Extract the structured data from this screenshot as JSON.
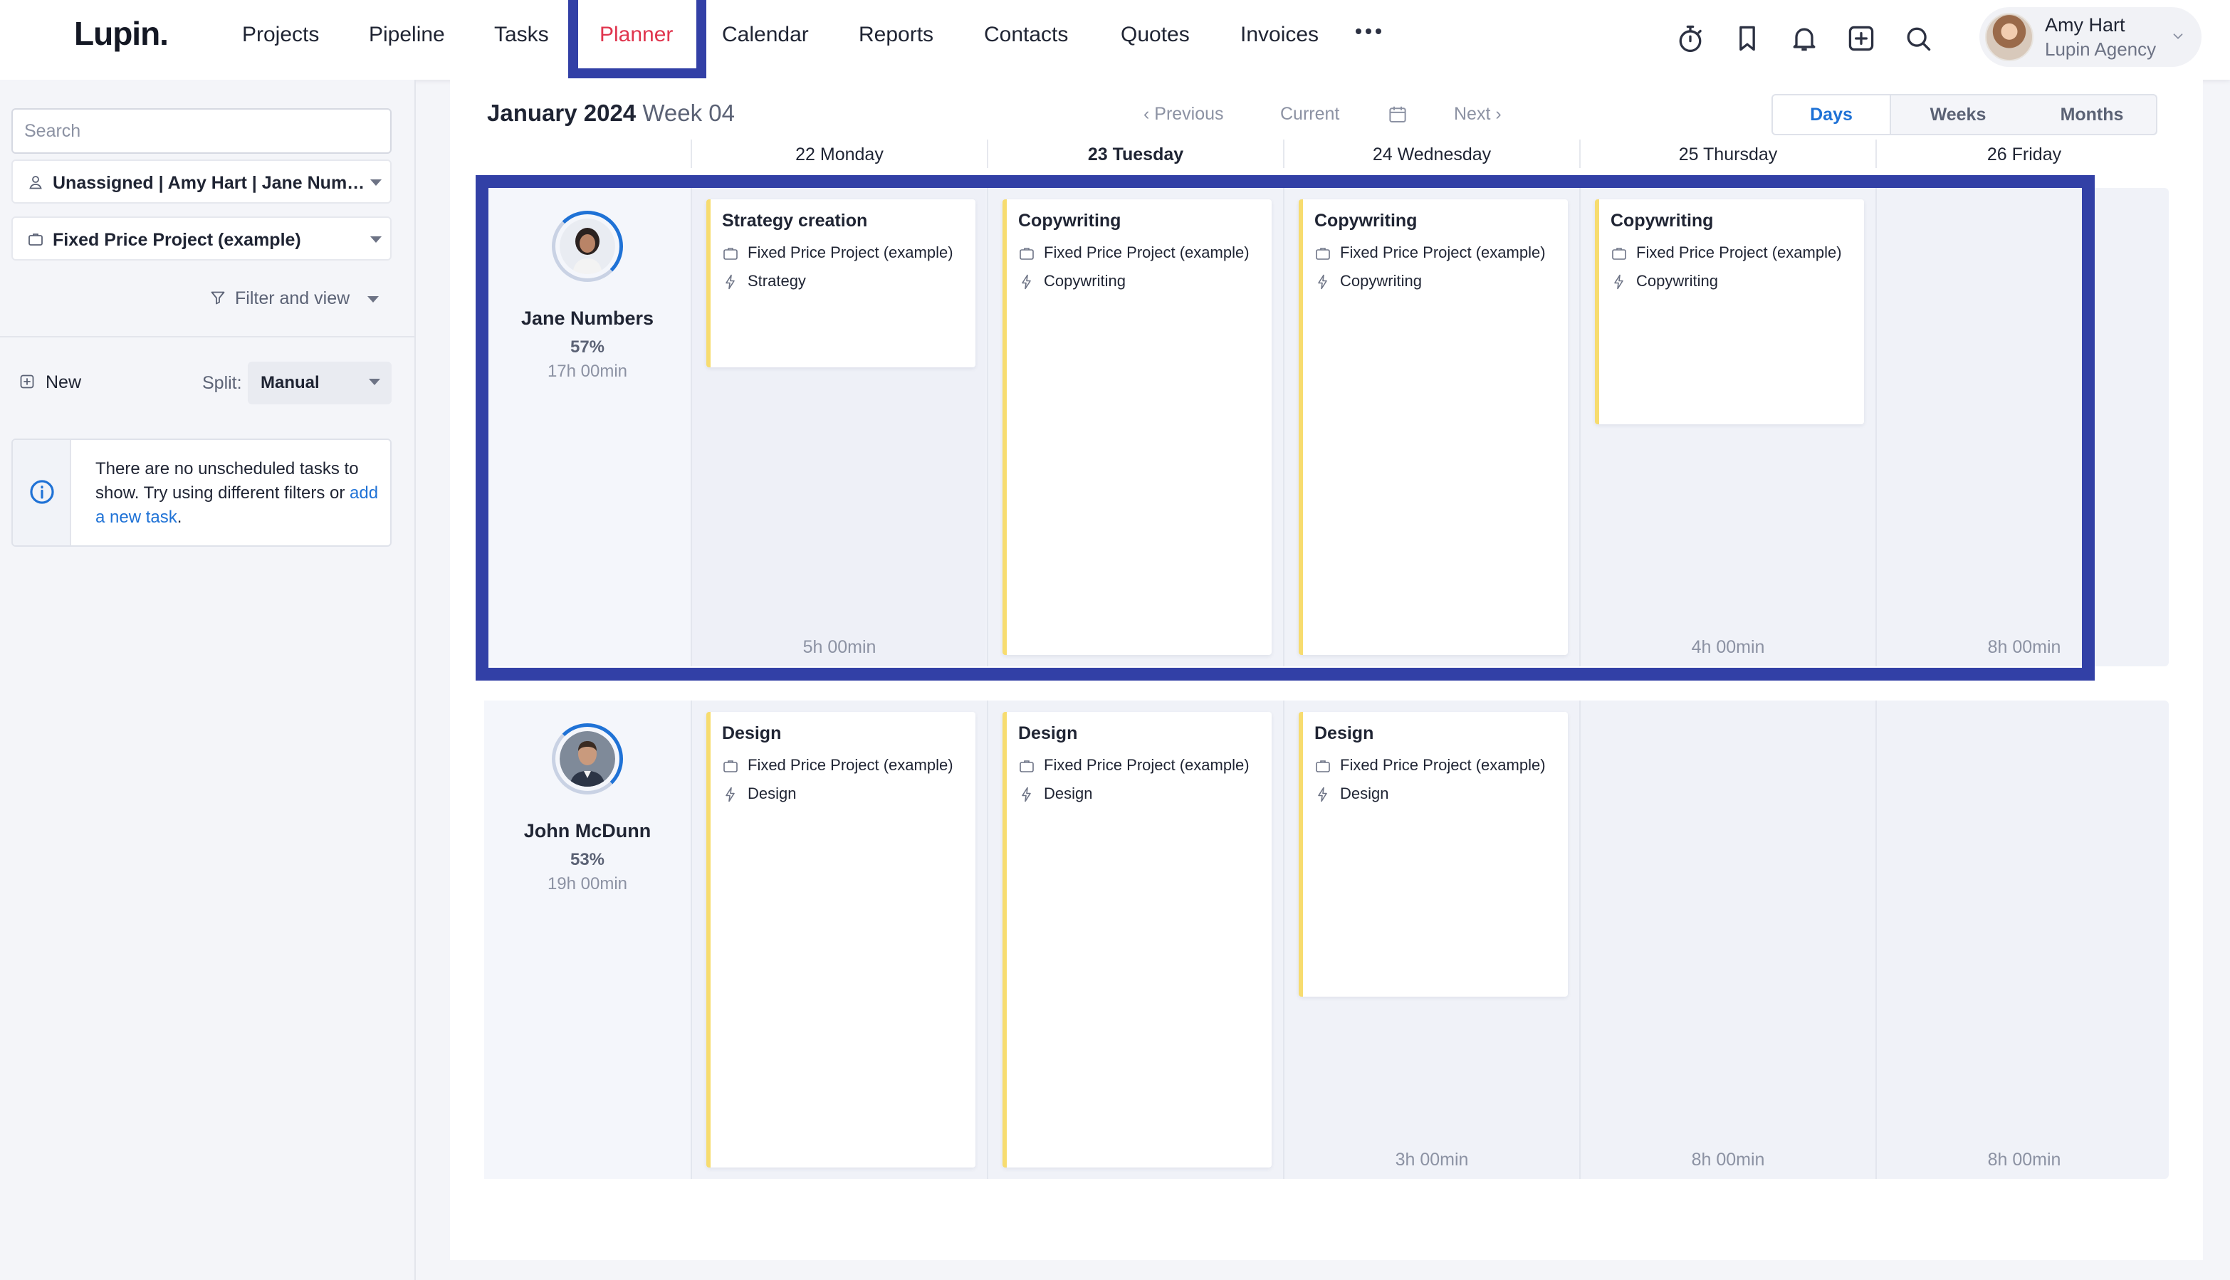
{
  "app": {
    "logo": "Lupin.",
    "nav": [
      "Projects",
      "Pipeline",
      "Tasks",
      "Planner",
      "Calendar",
      "Reports",
      "Contacts",
      "Quotes",
      "Invoices"
    ],
    "active_nav": "Planner",
    "user": {
      "name": "Amy Hart",
      "org": "Lupin Agency"
    },
    "icons": [
      "stopwatch-icon",
      "bookmark-icon",
      "bell-icon",
      "plus-square-icon",
      "search-icon"
    ]
  },
  "sidebar": {
    "search_placeholder": "Search",
    "assignee_filter": "Unassigned | Amy Hart | Jane Numbers",
    "project_filter": "Fixed Price Project (example)",
    "filter_view": "Filter and view",
    "new_label": "New",
    "split_label": "Split:",
    "split_value": "Manual",
    "info": {
      "text": "There are no unscheduled tasks to show. Try using different filters or ",
      "link": "add a new task",
      "end": "."
    }
  },
  "planner": {
    "month": "January 2024",
    "week": "Week 04",
    "previous": "Previous",
    "current": "Current",
    "next": "Next",
    "views": [
      "Days",
      "Weeks",
      "Months"
    ],
    "active_view": "Days",
    "days": [
      "22 Monday",
      "23 Tuesday",
      "24 Wednesday",
      "25 Thursday",
      "26 Friday"
    ],
    "today": "23 Tuesday",
    "people": [
      {
        "name": "Jane Numbers",
        "percent": "57%",
        "hours": "17h 00min",
        "day_totals": [
          "5h 00min",
          "",
          "",
          "4h 00min",
          "8h 00min"
        ],
        "tasks": [
          {
            "day": 0,
            "title": "Strategy creation",
            "project": "Fixed Price Project (example)",
            "type": "Strategy"
          },
          {
            "day": 1,
            "title": "Copywriting",
            "project": "Fixed Price Project (example)",
            "type": "Copywriting"
          },
          {
            "day": 2,
            "title": "Copywriting",
            "project": "Fixed Price Project (example)",
            "type": "Copywriting"
          },
          {
            "day": 3,
            "title": "Copywriting",
            "project": "Fixed Price Project (example)",
            "type": "Copywriting"
          }
        ]
      },
      {
        "name": "John McDunn",
        "percent": "53%",
        "hours": "19h 00min",
        "day_totals": [
          "",
          "",
          "3h 00min",
          "8h 00min",
          "8h 00min"
        ],
        "tasks": [
          {
            "day": 0,
            "title": "Design",
            "project": "Fixed Price Project (example)",
            "type": "Design"
          },
          {
            "day": 1,
            "title": "Design",
            "project": "Fixed Price Project (example)",
            "type": "Design"
          },
          {
            "day": 2,
            "title": "Design",
            "project": "Fixed Price Project (example)",
            "type": "Design"
          }
        ]
      }
    ]
  },
  "colors": {
    "accent": "#1f72d6",
    "active_nav": "#e0354e",
    "highlight": "#3240a6",
    "task_stripe": "#f7dc6f"
  }
}
